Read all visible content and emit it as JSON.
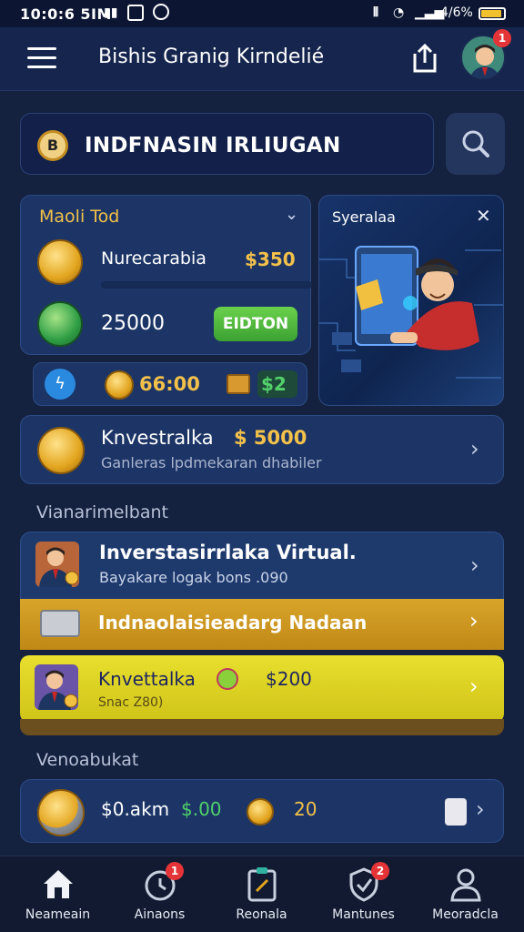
{
  "status_bar": {
    "time": "10:0:6 5IM",
    "battery": "4/6%"
  },
  "app_bar": {
    "title": "Bishis Granig Kirndelié",
    "avatar_badge": "1"
  },
  "search": {
    "coin_symbol": "B",
    "value": "INDFNASIN IRLIUGAN"
  },
  "mode_card": {
    "title": "Maoli Tod",
    "row1_label": "Nurecarabia",
    "row1_value": "$350",
    "row2_value": "25000",
    "button": "EIDTON"
  },
  "promo_card": {
    "title": "Syeralaa"
  },
  "stats_strip": {
    "coins": "66:00",
    "cash": "$2"
  },
  "invest_card": {
    "title": "Knvestralka",
    "amount": "$ 5000",
    "subtitle": "Ganleras lpdmekaran dhabiler"
  },
  "section1": {
    "title": "Vianarimelbant"
  },
  "rows": [
    {
      "title": "Inverstasirrlaka Virtual.",
      "subtitle": "Bayakare logak bons .090"
    },
    {
      "title": "Indnaolaisieadarg Nadaan"
    },
    {
      "title": "Knvettalka",
      "amount": "$200",
      "subtitle": "Snac Z80)"
    }
  ],
  "section2": {
    "title": "Venoabukat"
  },
  "bottom_card": {
    "a": "$0.akm",
    "b": "$.00",
    "c": "20"
  },
  "nav": [
    {
      "label": "Neameain",
      "icon": "home-icon"
    },
    {
      "label": "Ainaons",
      "icon": "clock-icon",
      "badge": "1"
    },
    {
      "label": "Reonala",
      "icon": "clipboard-icon"
    },
    {
      "label": "Mantunes",
      "icon": "shield-icon",
      "badge": "2"
    },
    {
      "label": "Meoradcla",
      "icon": "person-icon"
    }
  ],
  "colors": {
    "background": "#14213f",
    "gold": "#f3c14a",
    "green": "#4fd16a",
    "row_gold": "#d8a52a",
    "row_yellow": "#e8df2e"
  }
}
